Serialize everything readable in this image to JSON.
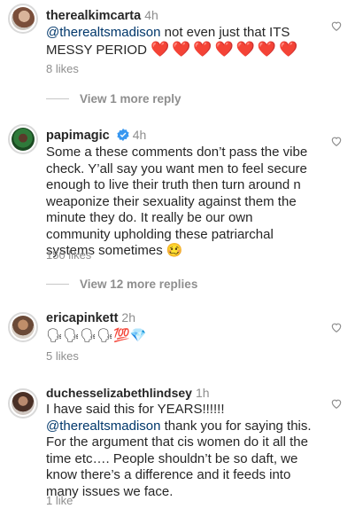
{
  "comments": [
    {
      "username": "therealkimcarta",
      "time": "4h",
      "mention": "@therealtsmadison",
      "text": " not even just that ITS MESSY PERIOD ",
      "emoji": "❤️❤️❤️❤️❤️❤️❤️",
      "likes": "8 likes",
      "view_more": "View 1 more reply"
    },
    {
      "username": "papimagic",
      "time": "4h",
      "text": "Some a these comments don’t pass the vibe check. Y’all say you want men to feel secure enough to live their truth then turn around n weaponize their sexuality against them the minute they do. It really be our own community upholding these patriarchal systems sometimes ",
      "emoji": "🥴",
      "likes": "150 likes",
      "view_more": "View 12 more replies"
    },
    {
      "username": "ericapinkett",
      "time": "2h",
      "emoji": "🗣🗣🗣🗣💯💎",
      "likes": "5 likes"
    },
    {
      "username": "duchesselizabethlindsey",
      "time": "1h",
      "text_line1": "I have said this for YEARS!!!!!!",
      "mention": "@therealtsmadison",
      "text": " thank you for saying this. For the argument that cis women do it all the time etc…. People shouldn’t be so daft, we know there’s a difference and it feeds into many issues we face.",
      "likes": "1 like"
    }
  ],
  "colors": {
    "text": "#262626",
    "secondary": "#8e8e8e",
    "mention": "#00376b",
    "verified": "#3897f0",
    "heart": "#e0242d"
  }
}
